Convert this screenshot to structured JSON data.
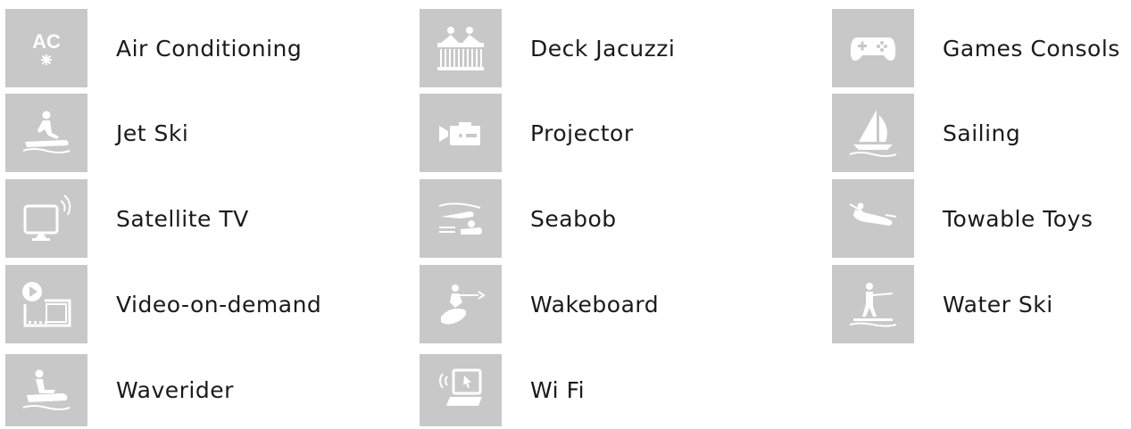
{
  "amenities": [
    {
      "label": "Air Conditioning",
      "icon": "air-conditioning-icon"
    },
    {
      "label": "Deck Jacuzzi",
      "icon": "jacuzzi-icon"
    },
    {
      "label": "Games Consols",
      "icon": "gamepad-icon"
    },
    {
      "label": "Jet Ski",
      "icon": "jet-ski-icon"
    },
    {
      "label": "Projector",
      "icon": "projector-icon"
    },
    {
      "label": "Sailing",
      "icon": "sailboat-icon"
    },
    {
      "label": "Satellite TV",
      "icon": "satellite-tv-icon"
    },
    {
      "label": "Seabob",
      "icon": "seabob-icon"
    },
    {
      "label": "Towable Toys",
      "icon": "towable-toy-icon"
    },
    {
      "label": "Video-on-demand",
      "icon": "video-on-demand-icon"
    },
    {
      "label": "Wakeboard",
      "icon": "wakeboard-icon"
    },
    {
      "label": "Water Ski",
      "icon": "water-ski-icon"
    },
    {
      "label": "Waverider",
      "icon": "waverider-icon"
    },
    {
      "label": "Wi Fi",
      "icon": "wifi-laptop-icon"
    }
  ],
  "ac_icon_text": "AC",
  "colors": {
    "tile": "#c8c8c8",
    "icon": "#ffffff",
    "text": "#1a1a1a"
  }
}
